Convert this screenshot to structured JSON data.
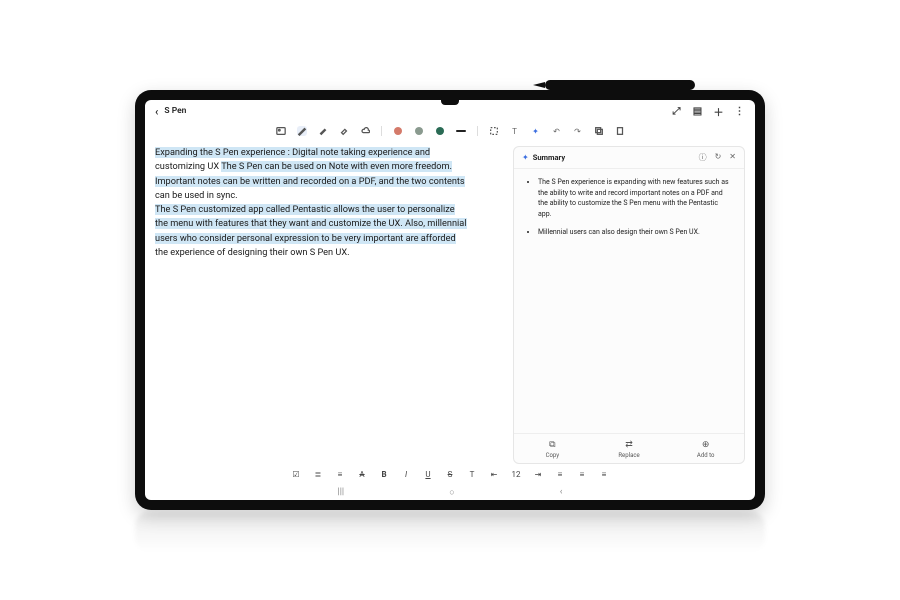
{
  "header": {
    "title": "S Pen"
  },
  "note": {
    "line1": "Expanding the S Pen experience : Digital note taking experience and",
    "line2a": "customizing UX ",
    "line2b": "The S Pen can be used on Note with even more freedom.",
    "line3": "Important notes can be written and recorded on a PDF, and the two contents",
    "line4": "can be used in sync.",
    "line5": "The S Pen customized app called Pentastic allows the user to personalize",
    "line6a": "the menu with features that they want and customize the UX. ",
    "line6b": "Also, millennial",
    "line7": "users who consider personal expression to be very important are afforded",
    "line8": "the experience of designing their own S Pen UX."
  },
  "summary": {
    "title": "Summary",
    "bullets": [
      "The S Pen experience is expanding with new features such as the ability to write and record important notes on a PDF and the ability to customize the S Pen menu with the Pentastic app.",
      "Millennial users can also design their own S Pen UX."
    ],
    "actions": {
      "copy": "Copy",
      "replace": "Replace",
      "addto": "Add to"
    }
  },
  "formatbar": {
    "checkbox": "☑",
    "bullets": "≣",
    "numbers": "≡",
    "clear": "A",
    "bold": "B",
    "italic": "I",
    "underline": "U",
    "strike": "S",
    "tt": "T",
    "indentL": "⇤",
    "fontsize": "12",
    "indentR": "⇥",
    "alignL": "≡",
    "alignC": "≡",
    "alignR": "≡"
  }
}
